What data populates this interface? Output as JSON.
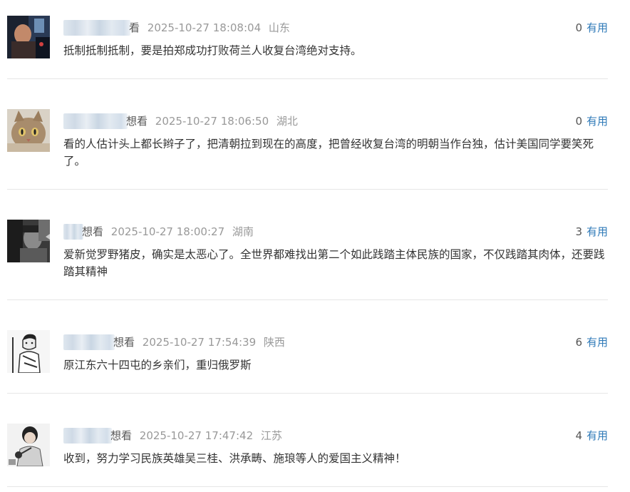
{
  "comments": [
    {
      "username_tail": "看",
      "timestamp": "2025-10-27 18:08:04",
      "location": "山东",
      "useful_count": "0",
      "useful_label": "有用",
      "content": "抵制抵制抵制，要是拍郑成功打败荷兰人收复台湾绝对支持。"
    },
    {
      "username_tail": "想看",
      "timestamp": "2025-10-27 18:06:50",
      "location": "湖北",
      "useful_count": "0",
      "useful_label": "有用",
      "content": "看的人估计头上都长辫子了，把清朝拉到现在的高度，把曾经收复台湾的明朝当作台独，估计美国同学要笑死了。"
    },
    {
      "username_tail": "想看",
      "timestamp": "2025-10-27 18:00:27",
      "location": "湖南",
      "useful_count": "3",
      "useful_label": "有用",
      "content": "爱新觉罗野猪皮，确实是太恶心了。全世界都难找出第二个如此践踏主体民族的国家，不仅践踏其肉体，还要践踏其精神"
    },
    {
      "username_tail": "想看",
      "timestamp": "2025-10-27 17:54:39",
      "location": "陕西",
      "useful_count": "6",
      "useful_label": "有用",
      "content": "原江东六十四屯的乡亲们，重归俄罗斯"
    },
    {
      "username_tail": "想看",
      "timestamp": "2025-10-27 17:47:42",
      "location": "江苏",
      "useful_count": "4",
      "useful_label": "有用",
      "content": "收到，努力学习民族英雄吴三桂、洪承畴、施琅等人的爱国主义精神！"
    }
  ]
}
